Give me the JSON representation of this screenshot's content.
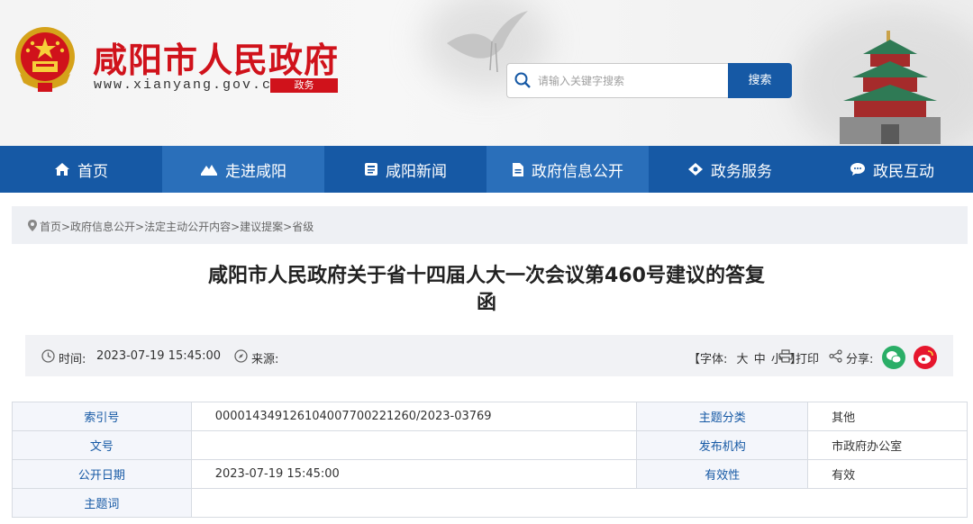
{
  "header": {
    "site_title": "咸阳市人民政府",
    "site_url": "www.xianyang.gov.cn",
    "site_tag": "政务",
    "search_placeholder": "请输入关键字搜索",
    "search_button": "搜索",
    "brand_red": "#d0121b",
    "brand_blue": "#1659a5"
  },
  "nav": {
    "items": [
      {
        "label": "首页",
        "icon": "home-icon"
      },
      {
        "label": "走进咸阳",
        "icon": "mountain-icon"
      },
      {
        "label": "咸阳新闻",
        "icon": "news-icon"
      },
      {
        "label": "政府信息公开",
        "icon": "document-icon"
      },
      {
        "label": "政务服务",
        "icon": "service-icon"
      },
      {
        "label": "政民互动",
        "icon": "chat-icon"
      }
    ]
  },
  "breadcrumb": {
    "text": "首页>政府信息公开>法定主动公开内容>建议提案>省级",
    "icon": "location-pin-icon"
  },
  "article": {
    "title_line1": "咸阳市人民政府关于省十四届人大一次会议第460号建议的答复",
    "title_line2": "函"
  },
  "meta": {
    "time_label": "时间:",
    "time_value": "2023-07-19 15:45:00",
    "source_label": "来源:",
    "font_label": "【字体:",
    "font_large": "大",
    "font_medium": "中",
    "font_small": "小",
    "font_close": "】",
    "print_label": "打印",
    "share_label": "分享:",
    "wechat_color": "#2aae67",
    "weibo_color": "#e6162d"
  },
  "info_table": {
    "rows": [
      {
        "k1": "索引号",
        "v1": "000014349126104007700221260/2023-03769",
        "k2": "主题分类",
        "v2": "其他"
      },
      {
        "k1": "文号",
        "v1": "",
        "k2": "发布机构",
        "v2": "市政府办公室"
      },
      {
        "k1": "公开日期",
        "v1": "2023-07-19 15:45:00",
        "k2": "有效性",
        "v2": "有效"
      },
      {
        "k1": "主题词",
        "v1": ""
      }
    ]
  }
}
